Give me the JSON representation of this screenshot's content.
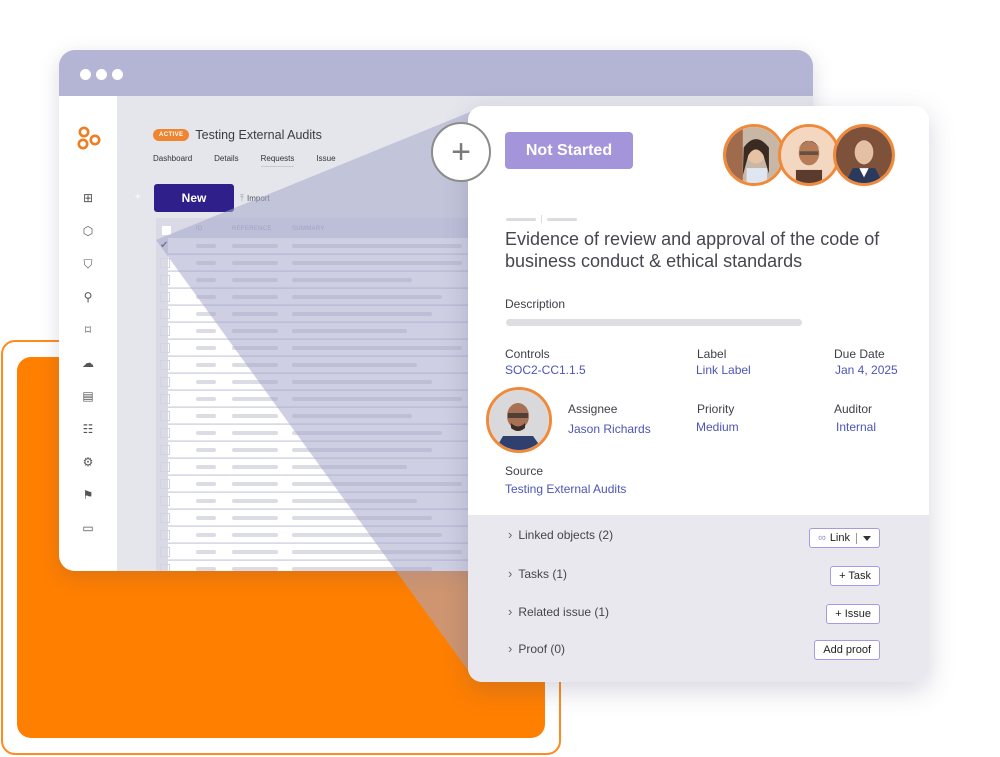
{
  "window": {
    "title_dots": 3,
    "sidebar_icons": [
      "layout-icon",
      "package-icon",
      "shield-icon",
      "workflow-icon",
      "bookmark-chat-icon",
      "cloud-upload-icon",
      "report-icon",
      "checklist-icon",
      "vendor-icon",
      "flag-icon",
      "ticket-icon"
    ]
  },
  "project": {
    "badge": "ACTIVE",
    "title": "Testing External Audits",
    "tabs": [
      {
        "label": "Dashboard"
      },
      {
        "label": "Details"
      },
      {
        "label": "Requests",
        "active": true
      },
      {
        "label": "Issue"
      }
    ],
    "new_label": "New",
    "import_label": "Import"
  },
  "table": {
    "columns": [
      "ID",
      "REFERENCE",
      "SUMMARY"
    ],
    "row_count": 23,
    "selected_rows": [
      0
    ]
  },
  "card": {
    "status": "Not Started",
    "add_user_symbol": "+",
    "title": "Evidence of review and approval of the code of business conduct & ethical standards",
    "description_label": "Description",
    "fields": {
      "controls_label": "Controls",
      "controls_value": "SOC2-CC1.1.5",
      "label_label": "Label",
      "label_value": "Link Label",
      "due_label": "Due Date",
      "due_value": "Jan 4, 2025",
      "assignee_label": "Assignee",
      "assignee_value": "Jason Richards",
      "priority_label": "Priority",
      "priority_value": "Medium",
      "auditor_label": "Auditor",
      "auditor_value": "Internal",
      "source_label": "Source",
      "source_value": "Testing External Audits"
    },
    "sections": [
      {
        "label": "Linked objects (2)",
        "button": "Link"
      },
      {
        "label": "Tasks (1)",
        "button": "+ Task"
      },
      {
        "label": "Related issue (1)",
        "button": "+ Issue"
      },
      {
        "label": "Proof (0)",
        "button": "Add proof"
      }
    ]
  },
  "colors": {
    "accent_orange": "#ff7f00",
    "brand_purple": "#2e1f8a",
    "status_purple": "#a495db",
    "link_blue": "#4c55b6",
    "titlebar": "#b4b5d4"
  }
}
